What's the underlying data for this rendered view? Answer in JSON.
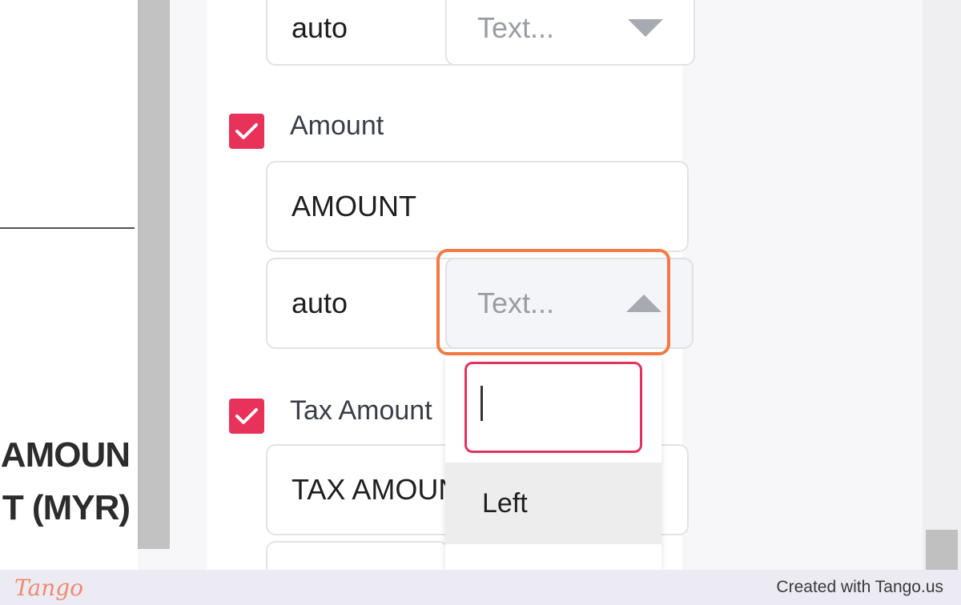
{
  "document_preview": {
    "heading_line1": "AMOUN",
    "heading_line2": "T (MYR)"
  },
  "fields": {
    "previous_field": {
      "width_value": "auto",
      "align_select_value": "Text..."
    },
    "amount": {
      "checked": true,
      "label": "Amount",
      "header_value": "AMOUNT",
      "width_value": "auto",
      "align_select_value": "Text..."
    },
    "tax_amount": {
      "checked": true,
      "label": "Tax Amount",
      "header_value": "TAX AMOUNT"
    }
  },
  "dropdown": {
    "search_value": "",
    "options": [
      "Left"
    ]
  },
  "colors": {
    "checkbox": "#e8325a",
    "highlight": "#f47a45",
    "search_border": "#e3325e"
  },
  "footer": {
    "logo": "Tango",
    "credit": "Created with Tango.us"
  }
}
